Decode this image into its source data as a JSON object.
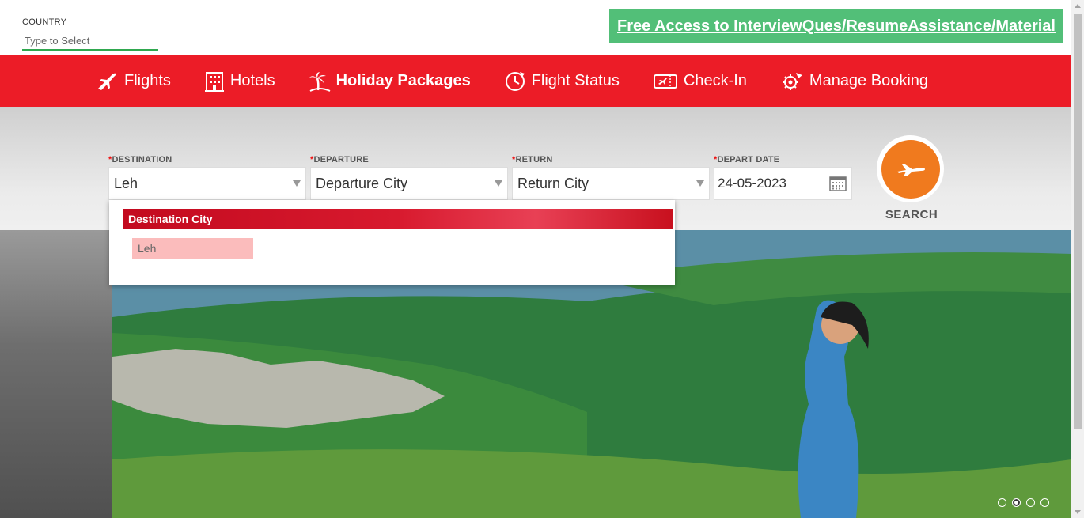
{
  "country": {
    "label": "COUNTRY",
    "placeholder": "Type to Select"
  },
  "promo": {
    "text": "Free Access to InterviewQues/ResumeAssistance/Material",
    "color": "#52bf78"
  },
  "nav": {
    "items": [
      {
        "label": "Flights",
        "icon": "plane-icon"
      },
      {
        "label": "Hotels",
        "icon": "hotel-building-icon"
      },
      {
        "label": "Holiday Packages",
        "icon": "palm-tree-icon",
        "active": true
      },
      {
        "label": "Flight Status",
        "icon": "clock-plane-icon"
      },
      {
        "label": "Check-In",
        "icon": "boarding-pass-icon"
      },
      {
        "label": "Manage Booking",
        "icon": "gear-plane-icon"
      }
    ],
    "color": "#ec1c27"
  },
  "form": {
    "destination": {
      "required_mark": "*",
      "label": "DESTINATION",
      "value": "Leh"
    },
    "departure": {
      "required_mark": "*",
      "label": "DEPARTURE",
      "value": "Departure City"
    },
    "return": {
      "required_mark": "*",
      "label": "RETURN",
      "value": "Return City"
    },
    "depart_date": {
      "required_mark": "*",
      "label": "DEPART DATE",
      "value": "24-05-2023"
    },
    "search": {
      "label": "SEARCH",
      "color": "#f07a1e"
    }
  },
  "dropdown": {
    "header": "Destination City",
    "options": [
      "Leh"
    ]
  },
  "carousel": {
    "slides": 4,
    "active_index": 1
  }
}
